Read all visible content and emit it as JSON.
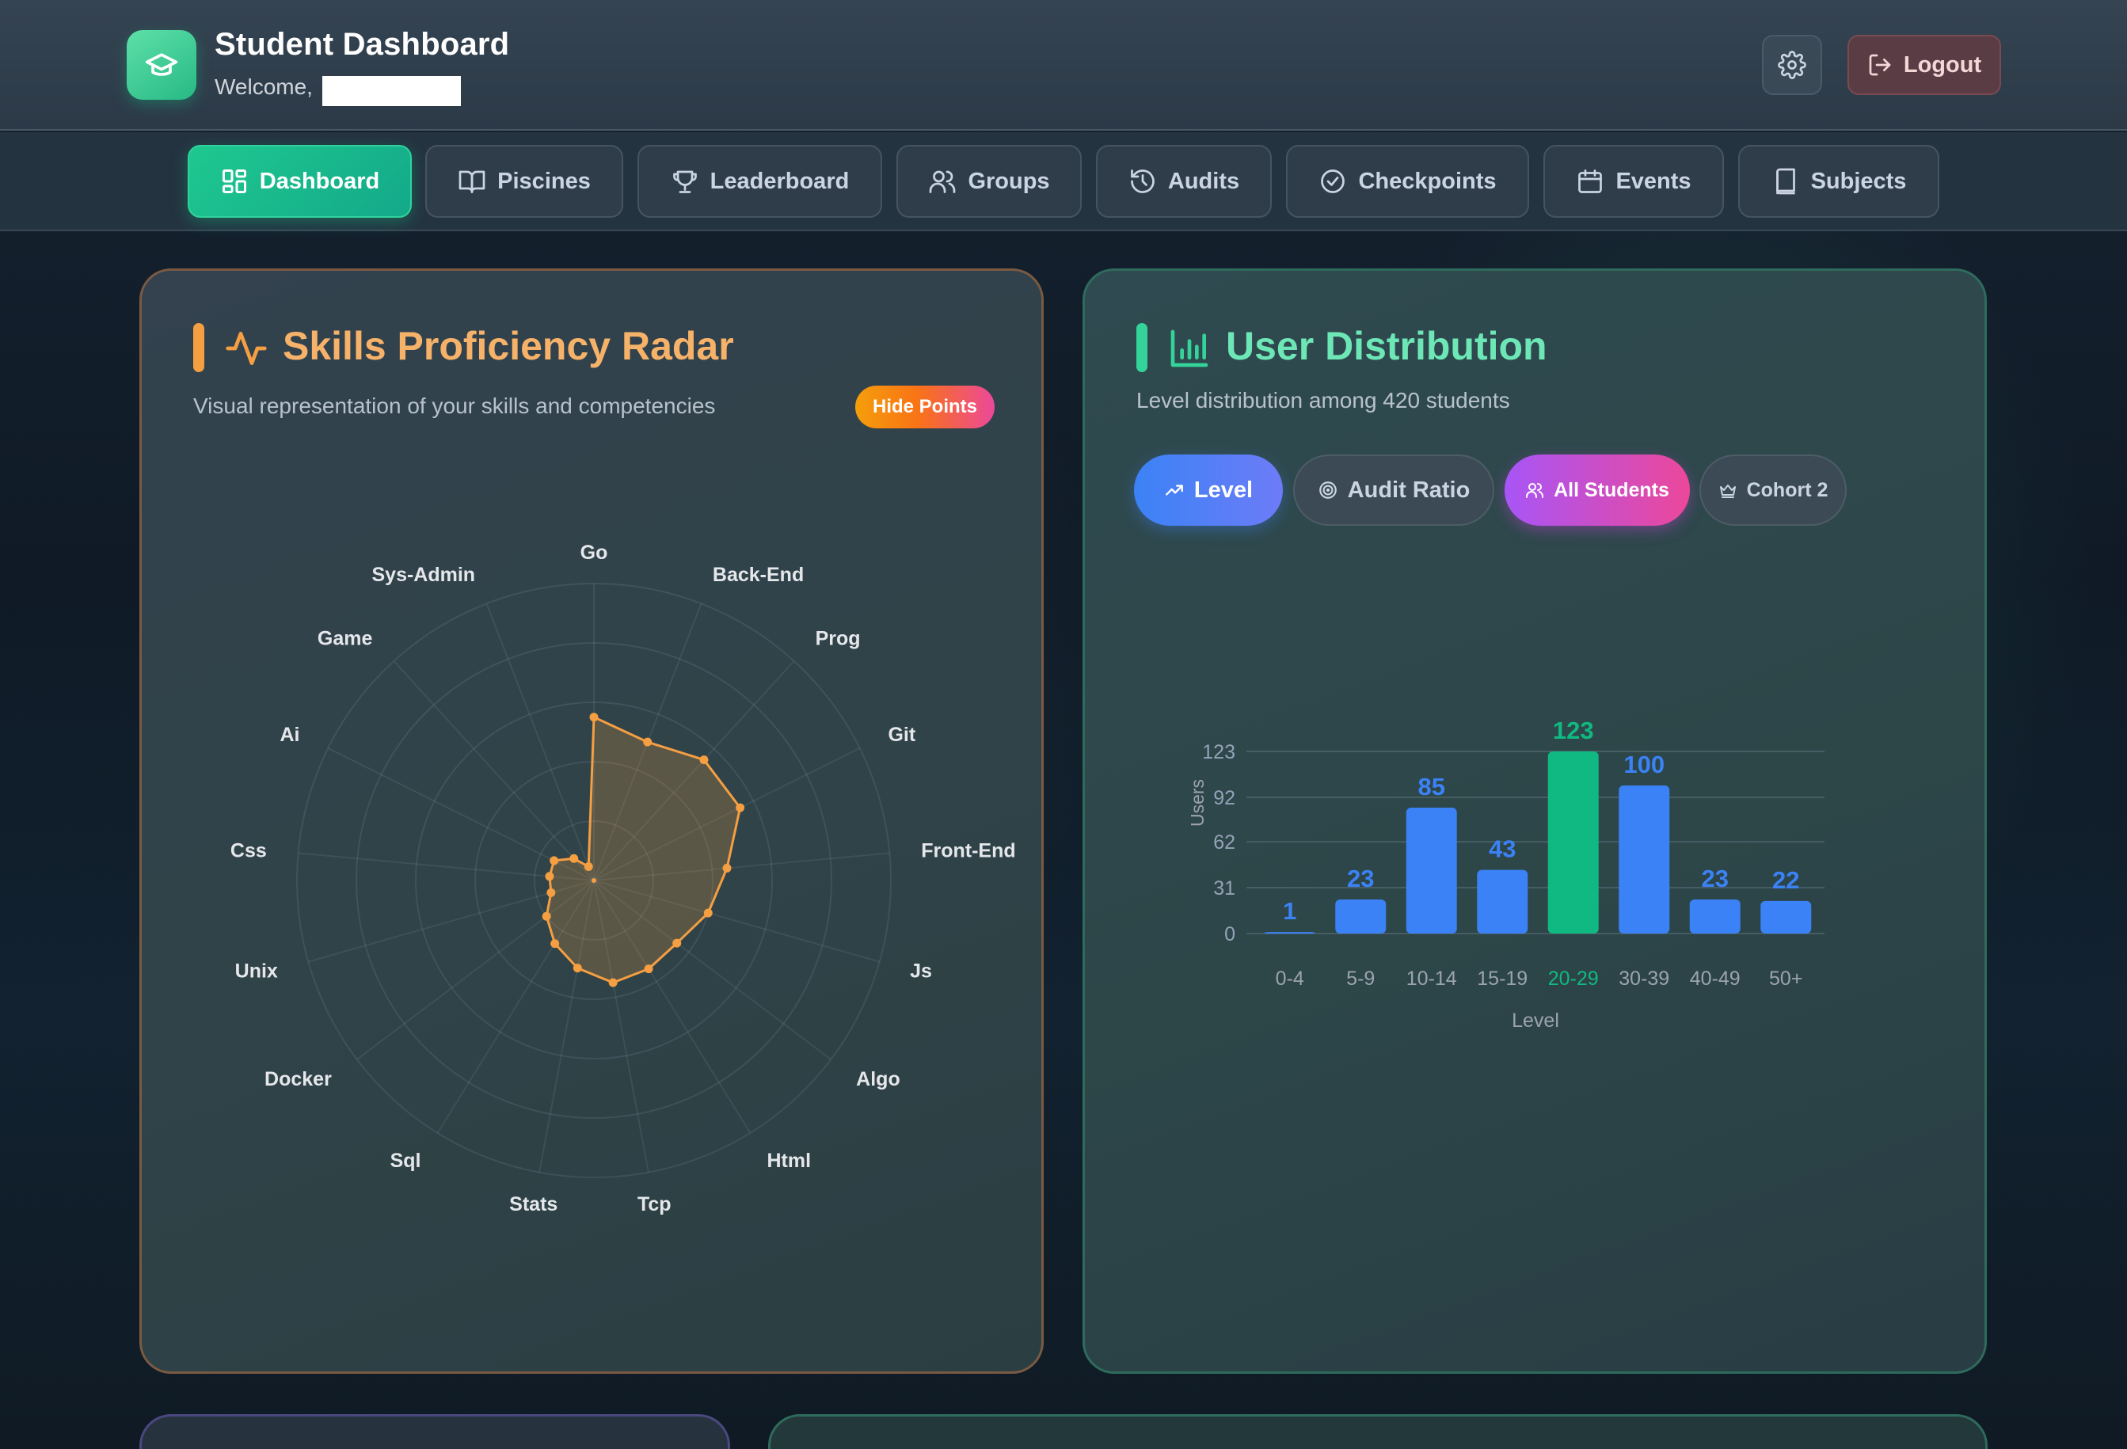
{
  "header": {
    "title": "Student Dashboard",
    "welcome": "Welcome,",
    "logout_label": "Logout"
  },
  "nav": {
    "items": [
      {
        "label": "Dashboard",
        "icon": "dashboard-icon",
        "active": true
      },
      {
        "label": "Piscines",
        "icon": "book-open-icon",
        "active": false
      },
      {
        "label": "Leaderboard",
        "icon": "trophy-icon",
        "active": false
      },
      {
        "label": "Groups",
        "icon": "users-icon",
        "active": false
      },
      {
        "label": "Audits",
        "icon": "history-icon",
        "active": false
      },
      {
        "label": "Checkpoints",
        "icon": "check-circle-icon",
        "active": false
      },
      {
        "label": "Events",
        "icon": "calendar-icon",
        "active": false
      },
      {
        "label": "Subjects",
        "icon": "book-icon",
        "active": false
      }
    ]
  },
  "radar": {
    "title": "Skills Proficiency Radar",
    "subtitle": "Visual representation of your skills and competencies",
    "toggle_label": "Hide Points",
    "accent": "#f59e42",
    "chart_data": {
      "type": "radar",
      "categories": [
        "Go",
        "Back-End",
        "Prog",
        "Git",
        "Front-End",
        "Js",
        "Algo",
        "Html",
        "Tcp",
        "Stats",
        "Sql",
        "Docker",
        "Unix",
        "Css",
        "Ai",
        "Game",
        "Sys-Admin"
      ],
      "values": [
        55,
        50,
        55,
        55,
        45,
        40,
        35,
        35,
        35,
        30,
        25,
        20,
        15,
        15,
        15,
        10,
        5
      ],
      "rmax": 100,
      "rings": 5
    }
  },
  "distribution": {
    "title": "User Distribution",
    "subtitle": "Level distribution among 420 students",
    "accent": "#34d399",
    "filters": {
      "level": "Level",
      "audit_ratio": "Audit Ratio",
      "all_students": "All Students",
      "cohort": "Cohort 2"
    },
    "chart_data": {
      "type": "bar",
      "categories": [
        "0-4",
        "5-9",
        "10-14",
        "15-19",
        "20-29",
        "30-39",
        "40-49",
        "50+"
      ],
      "values": [
        1,
        23,
        85,
        43,
        123,
        100,
        23,
        22
      ],
      "highlight": "20-29",
      "yticks": [
        0,
        31,
        62,
        92,
        123
      ],
      "ylim": [
        0,
        123
      ],
      "xlabel": "Level",
      "ylabel": "Users",
      "colors": {
        "default": "#3b82f6",
        "highlight": "#10b981"
      }
    }
  }
}
